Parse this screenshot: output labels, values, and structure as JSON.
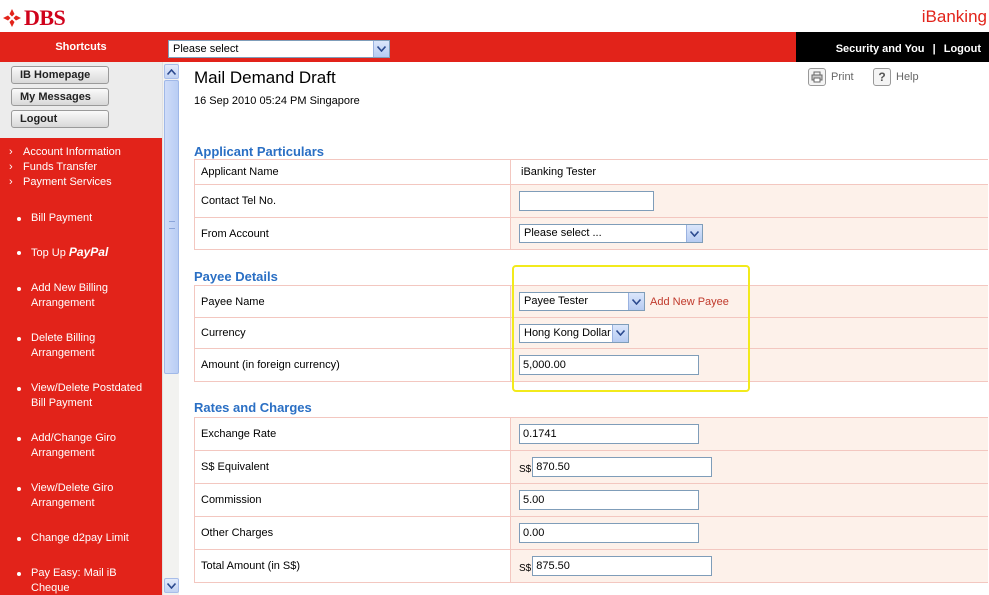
{
  "brand": {
    "logo_text": "DBS",
    "product": "iBanking",
    "brand_color": "#e2231a"
  },
  "topnav": {
    "shortcuts_label": "Shortcuts",
    "shortcut_select_value": "Please select",
    "security_label": "Security and You",
    "separator": "|",
    "logout_label": "Logout"
  },
  "sidebar": {
    "buttons": [
      "IB Homepage",
      "My Messages",
      "Logout"
    ],
    "top_items": [
      "Account Information",
      "Funds Transfer",
      "Payment Services"
    ],
    "sub_items": [
      {
        "label": "Bill Payment"
      },
      {
        "label": "Top Up",
        "extra": "PayPal"
      },
      {
        "label": "Add New Billing Arrangement"
      },
      {
        "label": "Delete Billing Arrangement"
      },
      {
        "label": "View/Delete Postdated Bill Payment"
      },
      {
        "label": "Add/Change Giro Arrangement"
      },
      {
        "label": "View/Delete Giro Arrangement"
      },
      {
        "label": "Change d2pay Limit"
      },
      {
        "label": "Pay Easy: Mail iB Cheque"
      }
    ]
  },
  "page": {
    "title": "Mail Demand Draft",
    "datetime": "16 Sep 2010 05:24 PM  Singapore",
    "print_label": "Print",
    "help_label": "Help"
  },
  "applicant": {
    "section_title": "Applicant Particulars",
    "name_label": "Applicant Name",
    "name_value": "iBanking Tester",
    "tel_label": "Contact Tel No.",
    "tel_value": "",
    "from_label": "From Account",
    "from_value": "Please select ..."
  },
  "payee": {
    "section_title": "Payee Details",
    "name_label": "Payee Name",
    "name_value": "Payee Tester",
    "add_new_label": "Add New Payee",
    "currency_label": "Currency",
    "currency_value": "Hong Kong Dollar",
    "amount_label": "Amount (in foreign currency)",
    "amount_value": "5,000.00"
  },
  "rates": {
    "section_title": "Rates and Charges",
    "currency_prefix": "S$",
    "rows": [
      {
        "label": "Exchange Rate",
        "value": "0.1741",
        "prefix": false
      },
      {
        "label": "S$ Equivalent",
        "value": "870.50",
        "prefix": true
      },
      {
        "label": "Commission",
        "value": "5.00",
        "prefix": false
      },
      {
        "label": "Other Charges",
        "value": "0.00",
        "prefix": false
      },
      {
        "label": "Total Amount (in S$)",
        "value": "875.50",
        "prefix": true
      }
    ]
  }
}
